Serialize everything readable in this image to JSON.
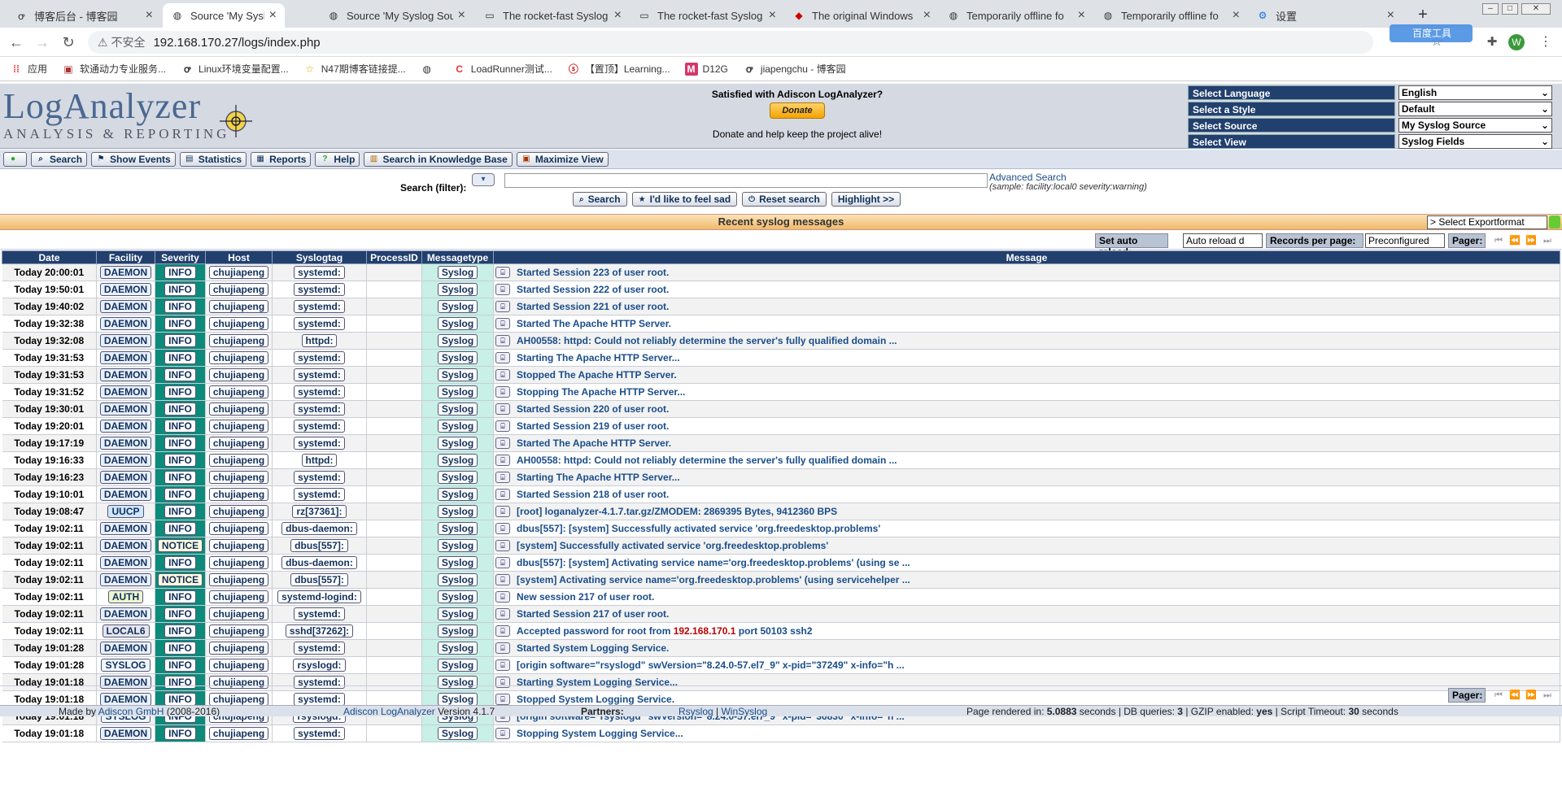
{
  "browser": {
    "tabs": [
      {
        "label": "博客后台 - 博客园"
      },
      {
        "label": "Source 'My Syslog Sou"
      },
      {
        "label": "Source 'My Syslog Sou"
      },
      {
        "label": "The rocket-fast Syslog"
      },
      {
        "label": "The rocket-fast Syslog"
      },
      {
        "label": "The original Windows"
      },
      {
        "label": "Temporarily offline fo"
      },
      {
        "label": "Temporarily offline fo"
      },
      {
        "label": "设置"
      }
    ],
    "security_label": "不安全",
    "url": "192.168.170.27/logs/index.php",
    "profile_initial": "W",
    "baidu_label": "百度工具",
    "bookmarks": [
      "应用",
      "软通动力专业服务...",
      "Linux环境变量配置...",
      "N47期博客链接提...",
      "",
      "LoadRunner测试...",
      "【置顶】Learning...",
      "D12G",
      "jiapengchu - 博客园"
    ]
  },
  "header": {
    "logo_main": "LogAnalyzer",
    "logo_sub": "ANALYSIS & REPORTING",
    "donate_title": "Satisfied with Adiscon LogAnalyzer?",
    "donate_button": "Donate",
    "donate_sub": "Donate and help keep the project alive!",
    "selectors": [
      {
        "label": "Select Language",
        "value": "English"
      },
      {
        "label": "Select a Style",
        "value": "Default"
      },
      {
        "label": "Select Source",
        "value": "My Syslog Source"
      },
      {
        "label": "Select View",
        "value": "Syslog Fields"
      }
    ]
  },
  "menu": [
    "Search",
    "Show Events",
    "Statistics",
    "Reports",
    "Help",
    "Search in Knowledge Base",
    "Maximize View"
  ],
  "search": {
    "filter_label": "Search (filter):",
    "filter_value": "",
    "advanced_link": "Advanced Search",
    "advanced_sample": "(sample: facility:local0 severity:warning)",
    "buttons": [
      "Search",
      "I'd like to feel sad",
      "Reset search",
      "Highlight >>"
    ]
  },
  "recent_title": "Recent syslog messages",
  "export_select": "> Select Exportformat",
  "toolbar": {
    "auto_reload_label": "Set auto reload:",
    "auto_reload_value": "Auto reload d",
    "records_label": "Records per page:",
    "records_value": "Preconfigured",
    "pager_label": "Pager:"
  },
  "table": {
    "columns": [
      "Date",
      "Facility",
      "Severity",
      "Host",
      "Syslogtag",
      "ProcessID",
      "Messagetype",
      "Message"
    ],
    "rows": [
      {
        "date": "Today 20:00:01",
        "facility": "DAEMON",
        "severity": "INFO",
        "host": "chujiapeng",
        "tag": "systemd:",
        "pid": "",
        "type": "Syslog",
        "message": "Started Session 223 of user root."
      },
      {
        "date": "Today 19:50:01",
        "facility": "DAEMON",
        "severity": "INFO",
        "host": "chujiapeng",
        "tag": "systemd:",
        "pid": "",
        "type": "Syslog",
        "message": "Started Session 222 of user root."
      },
      {
        "date": "Today 19:40:02",
        "facility": "DAEMON",
        "severity": "INFO",
        "host": "chujiapeng",
        "tag": "systemd:",
        "pid": "",
        "type": "Syslog",
        "message": "Started Session 221 of user root."
      },
      {
        "date": "Today 19:32:38",
        "facility": "DAEMON",
        "severity": "INFO",
        "host": "chujiapeng",
        "tag": "systemd:",
        "pid": "",
        "type": "Syslog",
        "message": "Started The Apache HTTP Server."
      },
      {
        "date": "Today 19:32:08",
        "facility": "DAEMON",
        "severity": "INFO",
        "host": "chujiapeng",
        "tag": "httpd:",
        "pid": "",
        "type": "Syslog",
        "message": "AH00558: httpd: Could not reliably determine the server's fully qualified domain ..."
      },
      {
        "date": "Today 19:31:53",
        "facility": "DAEMON",
        "severity": "INFO",
        "host": "chujiapeng",
        "tag": "systemd:",
        "pid": "",
        "type": "Syslog",
        "message": "Starting The Apache HTTP Server..."
      },
      {
        "date": "Today 19:31:53",
        "facility": "DAEMON",
        "severity": "INFO",
        "host": "chujiapeng",
        "tag": "systemd:",
        "pid": "",
        "type": "Syslog",
        "message": "Stopped The Apache HTTP Server."
      },
      {
        "date": "Today 19:31:52",
        "facility": "DAEMON",
        "severity": "INFO",
        "host": "chujiapeng",
        "tag": "systemd:",
        "pid": "",
        "type": "Syslog",
        "message": "Stopping The Apache HTTP Server..."
      },
      {
        "date": "Today 19:30:01",
        "facility": "DAEMON",
        "severity": "INFO",
        "host": "chujiapeng",
        "tag": "systemd:",
        "pid": "",
        "type": "Syslog",
        "message": "Started Session 220 of user root."
      },
      {
        "date": "Today 19:20:01",
        "facility": "DAEMON",
        "severity": "INFO",
        "host": "chujiapeng",
        "tag": "systemd:",
        "pid": "",
        "type": "Syslog",
        "message": "Started Session 219 of user root."
      },
      {
        "date": "Today 19:17:19",
        "facility": "DAEMON",
        "severity": "INFO",
        "host": "chujiapeng",
        "tag": "systemd:",
        "pid": "",
        "type": "Syslog",
        "message": "Started The Apache HTTP Server."
      },
      {
        "date": "Today 19:16:33",
        "facility": "DAEMON",
        "severity": "INFO",
        "host": "chujiapeng",
        "tag": "httpd:",
        "pid": "",
        "type": "Syslog",
        "message": "AH00558: httpd: Could not reliably determine the server's fully qualified domain ..."
      },
      {
        "date": "Today 19:16:23",
        "facility": "DAEMON",
        "severity": "INFO",
        "host": "chujiapeng",
        "tag": "systemd:",
        "pid": "",
        "type": "Syslog",
        "message": "Starting The Apache HTTP Server..."
      },
      {
        "date": "Today 19:10:01",
        "facility": "DAEMON",
        "severity": "INFO",
        "host": "chujiapeng",
        "tag": "systemd:",
        "pid": "",
        "type": "Syslog",
        "message": "Started Session 218 of user root."
      },
      {
        "date": "Today 19:08:47",
        "facility": "UUCP",
        "severity": "INFO",
        "host": "chujiapeng",
        "tag": "rz[37361]:",
        "pid": "",
        "type": "Syslog",
        "message": "[root] loganalyzer-4.1.7.tar.gz/ZMODEM: 2869395 Bytes, 9412360 BPS"
      },
      {
        "date": "Today 19:02:11",
        "facility": "DAEMON",
        "severity": "INFO",
        "host": "chujiapeng",
        "tag": "dbus-daemon:",
        "pid": "",
        "type": "Syslog",
        "message": "dbus[557]: [system] Successfully activated service 'org.freedesktop.problems'"
      },
      {
        "date": "Today 19:02:11",
        "facility": "DAEMON",
        "severity": "NOTICE",
        "host": "chujiapeng",
        "tag": "dbus[557]:",
        "pid": "",
        "type": "Syslog",
        "message": "[system] Successfully activated service 'org.freedesktop.problems'"
      },
      {
        "date": "Today 19:02:11",
        "facility": "DAEMON",
        "severity": "INFO",
        "host": "chujiapeng",
        "tag": "dbus-daemon:",
        "pid": "",
        "type": "Syslog",
        "message": "dbus[557]: [system] Activating service name='org.freedesktop.problems' (using se ..."
      },
      {
        "date": "Today 19:02:11",
        "facility": "DAEMON",
        "severity": "NOTICE",
        "host": "chujiapeng",
        "tag": "dbus[557]:",
        "pid": "",
        "type": "Syslog",
        "message": "[system] Activating service name='org.freedesktop.problems' (using servicehelper ..."
      },
      {
        "date": "Today 19:02:11",
        "facility": "AUTH",
        "severity": "INFO",
        "host": "chujiapeng",
        "tag": "systemd-logind:",
        "pid": "",
        "type": "Syslog",
        "message": "New session 217 of user root."
      },
      {
        "date": "Today 19:02:11",
        "facility": "DAEMON",
        "severity": "INFO",
        "host": "chujiapeng",
        "tag": "systemd:",
        "pid": "",
        "type": "Syslog",
        "message": "Started Session 217 of user root."
      },
      {
        "date": "Today 19:02:11",
        "facility": "LOCAL6",
        "severity": "INFO",
        "host": "chujiapeng",
        "tag": "sshd[37262]:",
        "pid": "",
        "type": "Syslog",
        "message": "Accepted password for root from ",
        "ip": "192.168.170.1",
        "message_tail": " port 50103 ssh2"
      },
      {
        "date": "Today 19:01:28",
        "facility": "DAEMON",
        "severity": "INFO",
        "host": "chujiapeng",
        "tag": "systemd:",
        "pid": "",
        "type": "Syslog",
        "message": "Started System Logging Service."
      },
      {
        "date": "Today 19:01:28",
        "facility": "SYSLOG",
        "severity": "INFO",
        "host": "chujiapeng",
        "tag": "rsyslogd:",
        "pid": "",
        "type": "Syslog",
        "message": "[origin software=\"rsyslogd\" swVersion=\"8.24.0-57.el7_9\" x-pid=\"37249\" x-info=\"h ..."
      },
      {
        "date": "Today 19:01:18",
        "facility": "DAEMON",
        "severity": "INFO",
        "host": "chujiapeng",
        "tag": "systemd:",
        "pid": "",
        "type": "Syslog",
        "message": "Starting System Logging Service..."
      },
      {
        "date": "Today 19:01:18",
        "facility": "DAEMON",
        "severity": "INFO",
        "host": "chujiapeng",
        "tag": "systemd:",
        "pid": "",
        "type": "Syslog",
        "message": "Stopped System Logging Service."
      },
      {
        "date": "Today 19:01:18",
        "facility": "SYSLOG",
        "severity": "INFO",
        "host": "chujiapeng",
        "tag": "rsyslogd:",
        "pid": "",
        "type": "Syslog",
        "message": "[origin software=\"rsyslogd\" swVersion=\"8.24.0-57.el7_9\" x-pid=\"36830\" x-info=\"h ..."
      },
      {
        "date": "Today 19:01:18",
        "facility": "DAEMON",
        "severity": "INFO",
        "host": "chujiapeng",
        "tag": "systemd:",
        "pid": "",
        "type": "Syslog",
        "message": "Stopping System Logging Service..."
      }
    ]
  },
  "footer": {
    "made_by_prefix": "Made by ",
    "made_by_link": "Adiscon GmbH",
    "made_by_years": " (2008-2016)",
    "product_link": "Adiscon LogAnalyzer",
    "product_version": " Version 4.1.7",
    "partners_label": "Partners:",
    "partner_1": "Rsyslog",
    "partner_2": "WinSyslog",
    "render_prefix": "Page rendered in: ",
    "render_time": "5.0883",
    "render_unit": " seconds  | DB queries: ",
    "db_queries": "3",
    "gzip_label": "  | GZIP enabled: ",
    "gzip_value": "yes",
    "timeout_label": "  | Script Timeout: ",
    "timeout_value": "30",
    "timeout_unit": " seconds"
  }
}
